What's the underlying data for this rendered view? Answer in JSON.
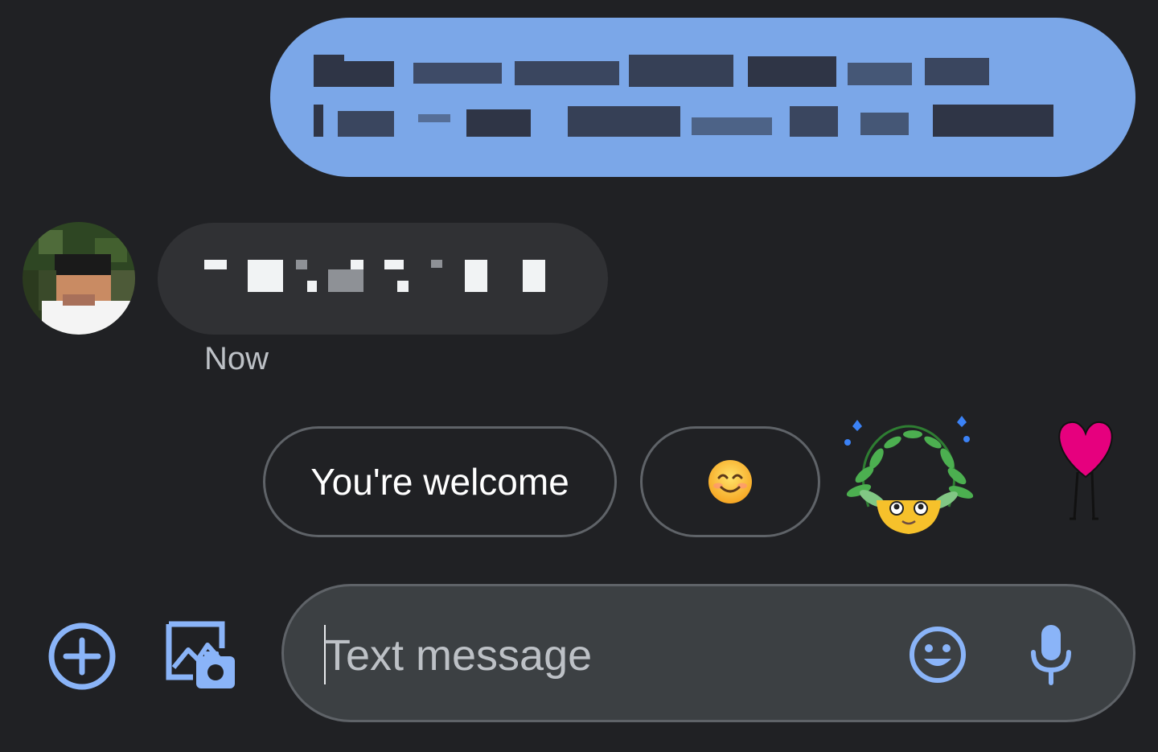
{
  "thread": {
    "timestamp": "Now"
  },
  "suggestions": {
    "text_reply": "You're welcome",
    "emoji_reply": "😊"
  },
  "composer": {
    "placeholder": "Text message"
  },
  "colors": {
    "background": "#202124",
    "sent_bubble": "#7ba7e8",
    "received_bubble": "#303134",
    "accent_icon": "#8ab4f8",
    "composer_bg": "#3c4043"
  },
  "icons": {
    "add": "add-circle-icon",
    "gallery": "gallery-camera-icon",
    "emoji": "emoji-icon",
    "mic": "microphone-icon"
  }
}
